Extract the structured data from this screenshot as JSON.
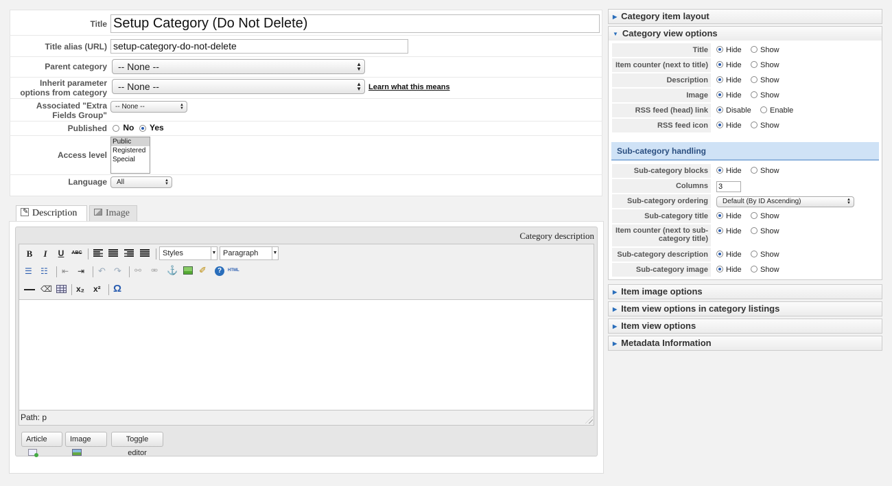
{
  "form": {
    "title_label": "Title",
    "title_value": "Setup Category (Do Not Delete)",
    "alias_label": "Title alias (URL)",
    "alias_value": "setup-category-do-not-delete",
    "parent_label": "Parent category",
    "parent_value": "-- None --",
    "inherit_label_1": "Inherit parameter",
    "inherit_label_2": "options from category",
    "inherit_value": "-- None --",
    "learn_link": "Learn what this means",
    "extra_label_1": "Associated \"Extra",
    "extra_label_2": "Fields Group\"",
    "extra_value": "-- None --",
    "published_label": "Published",
    "published_no": "No",
    "published_yes": "Yes",
    "access_label": "Access level",
    "access_options": [
      "Public",
      "Registered",
      "Special"
    ],
    "language_label": "Language",
    "language_value": "All"
  },
  "tabs": {
    "description": "Description",
    "image": "Image"
  },
  "editor": {
    "header": "Category description",
    "styles": "Styles",
    "paragraph": "Paragraph",
    "path": "Path: p",
    "btn_article": "Article",
    "btn_image": "Image",
    "btn_toggle": "Toggle editor",
    "bold": "B",
    "italic": "I",
    "underline": "U",
    "strike": "ABC",
    "html": "HTML",
    "sub": "x₂",
    "sup": "x²",
    "omega": "Ω"
  },
  "panel": {
    "item_layout": "Category item layout",
    "view_options": "Category view options",
    "view_rows": [
      {
        "label": "Title",
        "opt1": "Hide",
        "opt2": "Show"
      },
      {
        "label": "Item counter (next to title)",
        "opt1": "Hide",
        "opt2": "Show"
      },
      {
        "label": "Description",
        "opt1": "Hide",
        "opt2": "Show"
      },
      {
        "label": "Image",
        "opt1": "Hide",
        "opt2": "Show"
      },
      {
        "label": "RSS feed (head) link",
        "opt1": "Disable",
        "opt2": "Enable"
      },
      {
        "label": "RSS feed icon",
        "opt1": "Hide",
        "opt2": "Show"
      }
    ],
    "sub_heading": "Sub-category handling",
    "sub_blocks": {
      "label": "Sub-category blocks",
      "opt1": "Hide",
      "opt2": "Show"
    },
    "columns_label": "Columns",
    "columns_value": "3",
    "ordering_label": "Sub-category ordering",
    "ordering_value": "Default (By ID Ascending)",
    "sub_title": {
      "label": "Sub-category title",
      "opt1": "Hide",
      "opt2": "Show"
    },
    "sub_counter": {
      "label1": "Item counter (next to sub-",
      "label2": "category title)",
      "opt1": "Hide",
      "opt2": "Show"
    },
    "sub_desc": {
      "label": "Sub-category description",
      "opt1": "Hide",
      "opt2": "Show"
    },
    "sub_image": {
      "label": "Sub-category image",
      "opt1": "Hide",
      "opt2": "Show"
    },
    "item_image": "Item image options",
    "item_view_listings": "Item view options in category listings",
    "item_view": "Item view options",
    "metadata": "Metadata Information"
  },
  "colors": {
    "accent": "#2a6ebb",
    "sub_heading_bg": "#cfe2f6"
  }
}
